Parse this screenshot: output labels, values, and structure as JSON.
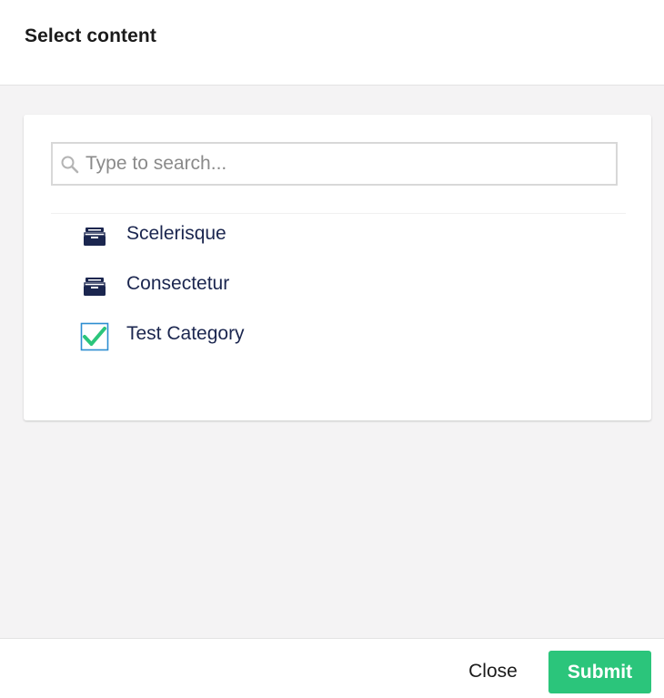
{
  "dialog": {
    "title": "Select content"
  },
  "search": {
    "placeholder": "Type to search...",
    "value": ""
  },
  "tree": {
    "items": [
      {
        "label": "Scelerisque",
        "icon": "archive-icon",
        "selected": false
      },
      {
        "label": "Consectetur",
        "icon": "archive-icon",
        "selected": false
      },
      {
        "label": "Test Category",
        "icon": "checkbox-checked-icon",
        "selected": true
      }
    ]
  },
  "footer": {
    "close_label": "Close",
    "submit_label": "Submit"
  },
  "colors": {
    "accent": "#2bc57b",
    "text_primary": "#1b264f",
    "body_background": "#f4f3f4",
    "icon_dark": "#1b264f",
    "check_green": "#2bc57b",
    "checkbox_border": "#2d8ed1"
  }
}
